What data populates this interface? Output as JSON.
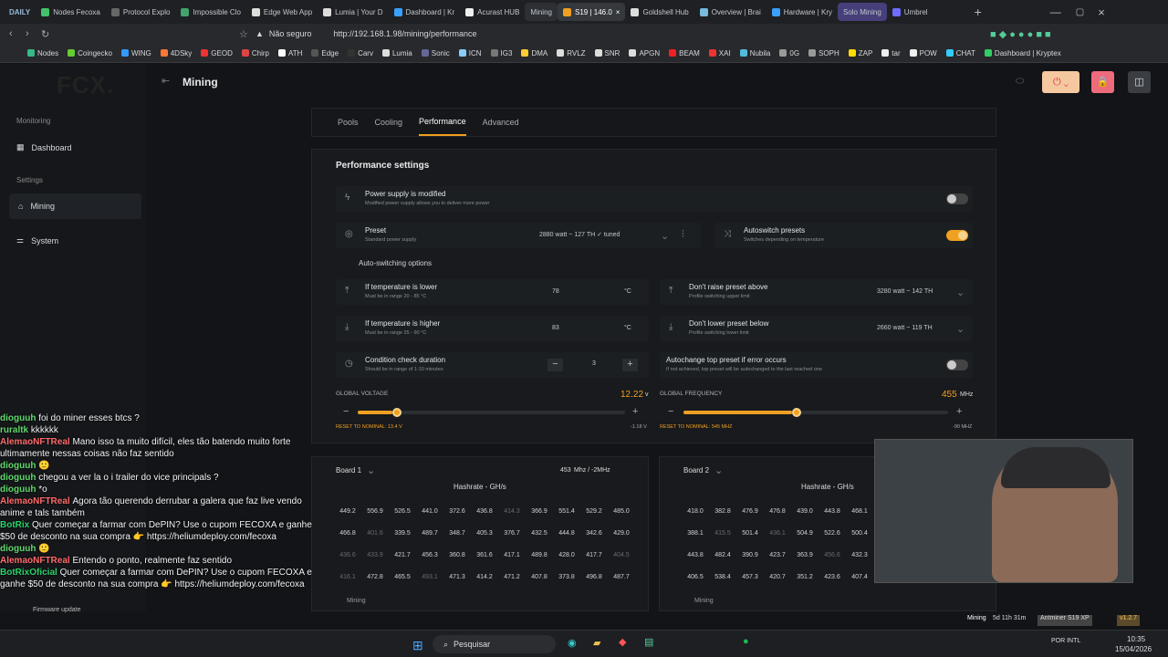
{
  "browser": {
    "tabs": [
      "DAILY",
      "Nodes Fecoxa",
      "Protocol Explo",
      "Impossible Clo",
      "Edge Web App",
      "Lumia | Your D",
      "Dashboard | Kr",
      "Acurast HUB",
      "Mining",
      "S19 | 146.0",
      "Goldshell Hub",
      "Overview | Brai",
      "Hardware | Kry",
      "Solo Mining",
      "Umbrel"
    ],
    "security": "Não seguro",
    "url": "http://192.168.1.98/mining/performance"
  },
  "bookmarks": [
    "Nodes",
    "Coingecko",
    "WING",
    "4DSky",
    "GEOD",
    "Chirp",
    "ATH",
    "Edge",
    "Carv",
    "Lumia",
    "Sonic",
    "ICN",
    "IG3",
    "DMA",
    "RVLZ",
    "SNR",
    "APGN",
    "BEAM",
    "XAI",
    "Nubila",
    "0G",
    "SOPH",
    "ZAP",
    "tar",
    "POW",
    "CHAT",
    "Dashboard | Kryptex"
  ],
  "app": {
    "logo": "FCX.",
    "monitoring": "Monitoring",
    "dashboard": "Dashboard",
    "settings": "Settings",
    "mining": "Mining",
    "system": "System",
    "page": "Mining"
  },
  "tabs": [
    "Pools",
    "Cooling",
    "Performance",
    "Advanced"
  ],
  "performance": {
    "title": "Performance settings",
    "power": {
      "label": "Power supply is modified",
      "sub": "Modified power supply allows you to deliver more power"
    },
    "preset": {
      "label": "Preset",
      "sub": "Standard power supply",
      "value": "2880 watt ~ 127 TH ✓ tuned"
    },
    "autoswitch": {
      "label": "Autoswitch presets",
      "sub": "Switches depending on temperature"
    },
    "options": "Auto-switching options",
    "lower": {
      "label": "If temperature is lower",
      "sub": "Must be in range 20 - 85 °C",
      "value": "78",
      "unit": "°C"
    },
    "higher": {
      "label": "If temperature is higher",
      "sub": "Must be in range 25 - 90 °C",
      "value": "83",
      "unit": "°C"
    },
    "raise": {
      "label": "Don't raise preset above",
      "sub": "Profile switching upper limit",
      "value": "3280 watt ~ 142 TH"
    },
    "lowerlimit": {
      "label": "Don't lower preset below",
      "sub": "Profile switching lower limit",
      "value": "2660 watt ~ 119 TH"
    },
    "duration": {
      "label": "Condition check duration",
      "sub": "Should be in range of 1-10 minutes",
      "value": "3"
    },
    "autochange": {
      "label": "Autochange top preset if error occurs",
      "sub": "If not achieved, top preset will be autochanged to the last reached one"
    },
    "voltage": {
      "label": "GLOBAL VOLTAGE",
      "value": "12.22",
      "unit": "v",
      "reset": "RESET TO NOMINAL: 13.4 V",
      "delta": "-1.18 V",
      "level": 0.13
    },
    "frequency": {
      "label": "GLOBAL FREQUENCY",
      "value": "455",
      "unit": "MHz",
      "reset": "RESET TO NOMINAL: 545 MHZ",
      "delta": "-90 MHZ",
      "level": 0.41
    }
  },
  "boards": [
    {
      "name": "Board 1",
      "freq": "453",
      "freq_unit": "Mhz / -2MHz",
      "title": "Hashrate - GH/s",
      "footer": "Mining",
      "rows": [
        [
          "449.2",
          "556.9",
          "526.5",
          "441.0",
          "372.6",
          "436.8",
          "414.3",
          "366.9",
          "551.4",
          "529.2",
          "485.0"
        ],
        [
          "466.8",
          "401.6",
          "339.5",
          "489.7",
          "348.7",
          "405.3",
          "376.7",
          "432.5",
          "444.8",
          "342.6",
          "429.0"
        ],
        [
          "436.6",
          "433.9",
          "421.7",
          "456.3",
          "360.8",
          "361.6",
          "417.1",
          "489.8",
          "428.0",
          "417.7",
          "404.5"
        ],
        [
          "416.1",
          "472.8",
          "465.5",
          "493.1",
          "471.3",
          "414.2",
          "471.2",
          "407.8",
          "373.8",
          "496.8",
          "487.7"
        ]
      ]
    },
    {
      "name": "Board 2",
      "title": "Hashrate - GH/s",
      "footer": "Mining",
      "rows": [
        [
          "418.0",
          "382.8",
          "476.9",
          "476.8",
          "439.0",
          "443.8",
          "468.1"
        ],
        [
          "388.1",
          "415.5",
          "501.4",
          "436.1",
          "504.9",
          "522.6",
          "500.4"
        ],
        [
          "443.8",
          "482.4",
          "390.9",
          "423.7",
          "363.9",
          "456.6",
          "432.3"
        ],
        [
          "406.5",
          "538.4",
          "457.3",
          "420.7",
          "351.2",
          "423.6",
          "407.4"
        ]
      ]
    }
  ],
  "chat": [
    {
      "user": "dioguuh",
      "text": "foi do miner esses btcs ?"
    },
    {
      "user": "ruraltk",
      "text": "kkkkkk"
    },
    {
      "user": "AlemaoNFTReal",
      "text": "Mano isso ta muito difícil, eles tão batendo muito forte ultimamente nessas coisas não faz sentido"
    },
    {
      "user": "dioguuh",
      "text": "🙂"
    },
    {
      "user": "dioguuh",
      "text": "chegou a ver la o i trailer do vice principals ?"
    },
    {
      "user": "dioguuh",
      "text": "*o"
    },
    {
      "user": "AlemaoNFTReal",
      "text": "Agora tão querendo derrubar a galera que faz live vendo anime e tals também"
    },
    {
      "user": "BotRix",
      "text": "Quer começar a farmar com DePIN? Use o cupom FECOXA e ganhe $50 de desconto na sua compra 👉 https://heliumdeploy.com/fecoxa"
    },
    {
      "user": "dioguuh",
      "text": "🙂"
    },
    {
      "user": "AlemaoNFTReal",
      "text": "Entendo o ponto, realmente faz sentido"
    },
    {
      "user": "BotRixOficial",
      "text": "Quer começar a farmar com DePIN? Use o cupom FECOXA e ganhe $50 de desconto na sua compra 👉 https://heliumdeploy.com/fecoxa"
    }
  ],
  "overlay": {
    "firmware": "Firmware update",
    "status": "Mining",
    "uptime": "5d 11h 31m",
    "miner": "Antminer S19 XP",
    "version": "v1.2.7"
  },
  "taskbar": {
    "search": "Pesquisar",
    "lang": "POR INTL",
    "time": "10:35",
    "date": "15/04/2026"
  },
  "colors": {
    "accent": "#f0a020",
    "background": "#121417"
  }
}
